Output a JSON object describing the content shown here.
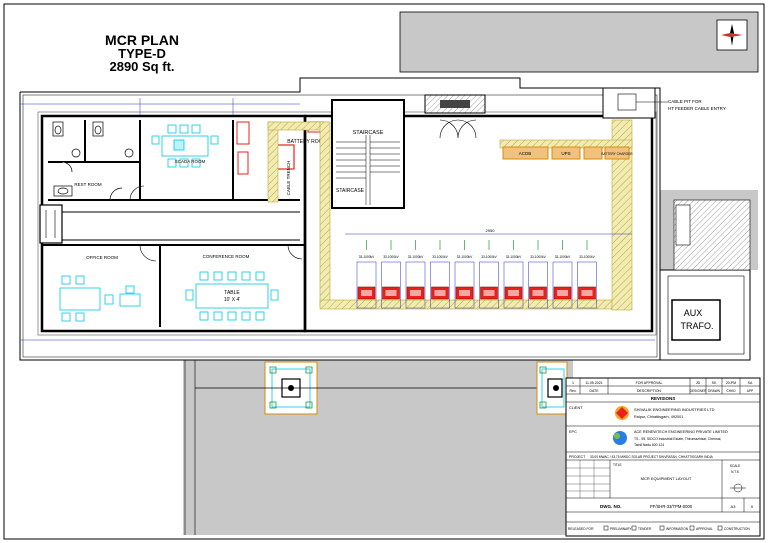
{
  "title": {
    "line1": "MCR PLAN",
    "line2": "TYPE-D",
    "line3": "2890 Sq ft."
  },
  "rooms": {
    "scada": "SCADA ROOM",
    "rest": "REST ROOM",
    "battery": "BATTERY ROOM",
    "staircase1": "STAIRCASE",
    "staircase2": "STAIRCASE",
    "office": "OFFICE ROOM",
    "conference": "CONFERENCE ROOM",
    "table_label": "TABLE",
    "table_size": "10' X 4'",
    "aux_trafo_1": "AUX",
    "aux_trafo_2": "TRAFO."
  },
  "annotations": {
    "cable_pit_1": "CABLE PIT FOR",
    "cable_pit_2": "HT FEEDER CABLE ENTRY",
    "cable_trench": "CABLE TRENCH",
    "aux_panel": "ACDB",
    "ups": "UPS",
    "battery_charger": "BATTERY CHARGER",
    "panel_dims": "2950",
    "panel_label": "33 / 0.433 kV"
  },
  "panels": [
    "33-1000kV",
    "33-1000kV",
    "33-1000kV",
    "33-1000kV",
    "33-1000kV",
    "33-1000kV",
    "33-1000kV",
    "33-1000kV",
    "33-1000kV",
    "33-1000kV"
  ],
  "title_block": {
    "revision_header": "REVISIONS",
    "rev_row": [
      "1",
      "11.05.2021",
      "FOR APPROVAL",
      "JD",
      "SK",
      "20-PM",
      "SA"
    ],
    "rev_head": [
      "Rev.",
      "DATE",
      "DESCRIPTION",
      "DESIGNER",
      "DRAWN",
      "CHKD",
      "APP"
    ],
    "client_label": "CLIENT",
    "client_name": "SHIVALIK ENGINEERING INDUSTRIES LTD",
    "client_address": "Raipur, Chhattisgarh, 492001",
    "epc_label": "EPC",
    "epc_name": "ACE RENEWTECH ENGINEERING PRIVATE LIMITED",
    "epc_address_1": "TS - 95, SIDCO Industrial Estate, Thirumazhisai, Chennai,",
    "epc_address_2": "Tamil Nadu 600 124",
    "project_label": "PROJECT",
    "project_name": "33.00 MWAC / 43.75 MWDC SOLAR PROJECT SHIVRATAN, CHHATTISGARH INDIA",
    "title_label": "TITLE",
    "drawing_title": "MCR EQUIPMENT LAYOUT",
    "scale_label": "SCALE",
    "scale_value": "N.T.S",
    "dwg_no_label": "DWG. NO.",
    "dwg_no": "PF/SHR-33/TPM-0000",
    "released_for": "RELEASED FOR",
    "rel_options": [
      "PRELIMINARY",
      "TENDER",
      "INFORMATION",
      "APPROVAL",
      "CONSTRUCTION"
    ],
    "sheet": "A3",
    "rev": "0"
  },
  "colors": {
    "wall": "#000000",
    "cyan": "#00c8e6",
    "red": "#e8211c",
    "orange": "#d98a10",
    "yellow_hatch": "#e8df8a",
    "blue": "#2233cc",
    "green": "#1f9a3a",
    "grey_fill": "#c8c8c8"
  }
}
